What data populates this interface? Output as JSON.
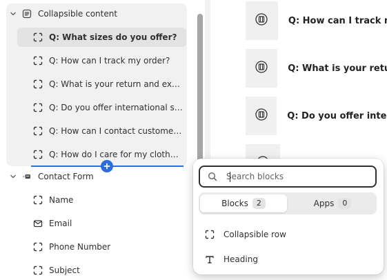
{
  "sidebar": {
    "section": {
      "label": "Collapsible content",
      "icon": "text-block-icon",
      "expanded": true
    },
    "children": [
      {
        "label": "Q: What sizes do you offer?",
        "selected": true
      },
      {
        "label": "Q: How can I track my order?"
      },
      {
        "label": "Q: What is your return and exch..."
      },
      {
        "label": "Q: Do you offer international shi..."
      },
      {
        "label": "Q: How can I contact customer s..."
      },
      {
        "label": "Q: How do I care for my clothes ..."
      }
    ],
    "contact": {
      "label": "Contact Form",
      "icon": "form-icon",
      "fields": [
        {
          "label": "Name",
          "icon": "dashed-square-icon"
        },
        {
          "label": "Email",
          "icon": "envelope-icon"
        },
        {
          "label": "Phone Number",
          "icon": "dashed-square-icon"
        },
        {
          "label": "Subject",
          "icon": "dashed-square-icon"
        }
      ]
    }
  },
  "preview": {
    "faqs": [
      {
        "question": "Q: How can I track m"
      },
      {
        "question": "Q: What is your retur"
      },
      {
        "question": "Q: Do you offer intern"
      }
    ]
  },
  "popover": {
    "search_placeholder": "Search blocks",
    "tabs": [
      {
        "label": "Blocks",
        "count": "2",
        "active": true
      },
      {
        "label": "Apps",
        "count": "0",
        "active": false
      }
    ],
    "items": [
      {
        "label": "Collapsible row",
        "icon": "dashed-square-icon"
      },
      {
        "label": "Heading",
        "icon": "heading-t-icon"
      }
    ]
  },
  "colors": {
    "accent": "#2d6cdf",
    "selected_bg": "#e3e3e3",
    "section_bg": "#f1f1f1"
  }
}
